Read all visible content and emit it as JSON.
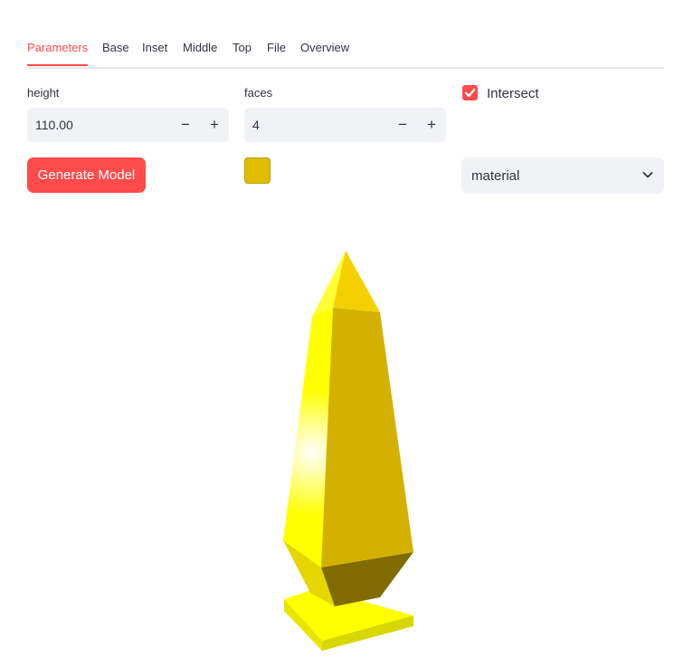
{
  "tabs": [
    {
      "label": "Parameters",
      "active": true
    },
    {
      "label": "Base"
    },
    {
      "label": "Inset"
    },
    {
      "label": "Middle"
    },
    {
      "label": "Top"
    },
    {
      "label": "File"
    },
    {
      "label": "Overview"
    }
  ],
  "fields": {
    "height": {
      "label": "height",
      "value": "110.00"
    },
    "faces": {
      "label": "faces",
      "value": "4"
    }
  },
  "stepper": {
    "minus": "−",
    "plus": "+"
  },
  "intersect": {
    "label": "Intersect",
    "checked": true
  },
  "generate_button": "Generate Model",
  "color_swatch": "#e0bb00",
  "material_select": {
    "value": "material"
  },
  "colors": {
    "accent": "#ff4b4b",
    "input_bg": "#f0f2f6"
  }
}
